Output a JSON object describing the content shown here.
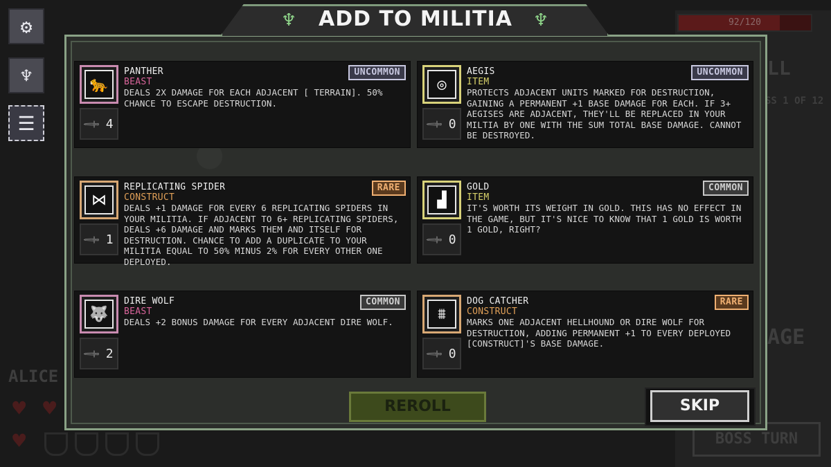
{
  "title": "ADD TO MILITIA",
  "background": {
    "hp_text": "92/120",
    "hp_fraction": 0.767,
    "player_name": "ALICE",
    "boss_label": "BOSS TURN",
    "age_fragment": "AGE",
    "ll_fragment": "LL",
    "progress_fragment": "SS 1 OF 12"
  },
  "sidebar": {
    "items": [
      {
        "icon": "gear-icon",
        "glyph": "⚙"
      },
      {
        "icon": "eagle-icon",
        "glyph": "♆"
      },
      {
        "icon": "list-icon",
        "glyph": "☰"
      }
    ]
  },
  "cards": [
    {
      "name": "PANTHER",
      "type": "BEAST",
      "type_class": "beast",
      "rarity": "UNCOMMON",
      "rarity_class": "uncommon",
      "damage": "4",
      "icon": "panther-icon",
      "glyph": "🐆",
      "border_color": "#c98bb0",
      "description": "DEALS 2X DAMAGE FOR EACH ADJACENT [ TERRAIN]. 50% CHANCE TO ESCAPE DESTRUCTION."
    },
    {
      "name": "AEGIS",
      "type": "ITEM",
      "type_class": "item",
      "rarity": "UNCOMMON",
      "rarity_class": "uncommon",
      "damage": "0",
      "icon": "shield-ring-icon",
      "glyph": "◎",
      "border_color": "#d8d27a",
      "description": "PROTECTS ADJACENT UNITS MARKED FOR DESTRUCTION, GAINING A PERMANENT +1 BASE DAMAGE FOR EACH. IF 3+ AEGISES ARE ADJACENT, THEY'LL BE REPLACED IN YOUR MILTIA BY ONE WITH THE SUM TOTAL BASE DAMAGE. CANNOT BE DESTROYED."
    },
    {
      "name": "REPLICATING SPIDER",
      "type": "CONSTRUCT",
      "type_class": "construct",
      "rarity": "RARE",
      "rarity_class": "rare",
      "damage": "1",
      "icon": "spider-icon",
      "glyph": "⋈",
      "border_color": "#d8a874",
      "description": "DEALS +1 DAMAGE FOR EVERY 6 REPLICATING SPIDERS IN YOUR MILITIA. IF ADJACENT TO 6+ REPLICATING SPIDERS, DEALS +6 DAMAGE AND MARKS THEM AND ITSELF FOR DESTRUCTION. CHANCE TO ADD A DUPLICATE TO YOUR MILITIA EQUAL TO 50% MINUS 2% FOR EVERY OTHER ONE DEPLOYED."
    },
    {
      "name": "GOLD",
      "type": "ITEM",
      "type_class": "item",
      "rarity": "COMMON",
      "rarity_class": "common",
      "damage": "0",
      "icon": "gold-icon",
      "glyph": "▟",
      "border_color": "#d8d27a",
      "description": "IT'S WORTH ITS WEIGHT IN GOLD. THIS HAS NO EFFECT IN THE GAME, BUT IT'S NICE TO KNOW THAT 1 GOLD IS WORTH 1 GOLD, RIGHT?"
    },
    {
      "name": "DIRE WOLF",
      "type": "BEAST",
      "type_class": "beast",
      "rarity": "COMMON",
      "rarity_class": "common",
      "damage": "2",
      "icon": "wolf-icon",
      "glyph": "🐺",
      "border_color": "#c98bb0",
      "description": "DEALS +2 BONUS DAMAGE FOR EVERY ADJACENT DIRE WOLF."
    },
    {
      "name": "DOG CATCHER",
      "type": "CONSTRUCT",
      "type_class": "construct",
      "rarity": "RARE",
      "rarity_class": "rare",
      "damage": "0",
      "icon": "dog-catcher-icon",
      "glyph": "⩩",
      "border_color": "#d8a874",
      "description": "MARKS ONE ADJACENT HELLHOUND OR DIRE WOLF FOR DESTRUCTION, ADDING PERMANENT +1 TO EVERY DEPLOYED [CONSTRUCT]'S BASE DAMAGE."
    }
  ],
  "buttons": {
    "reroll": "REROLL",
    "skip": "SKIP"
  },
  "colors": {
    "beast": "#d9649a",
    "item": "#d8d26a",
    "construct": "#e1a058",
    "frame": "#8aa286",
    "emblem": "#8fd58a"
  }
}
